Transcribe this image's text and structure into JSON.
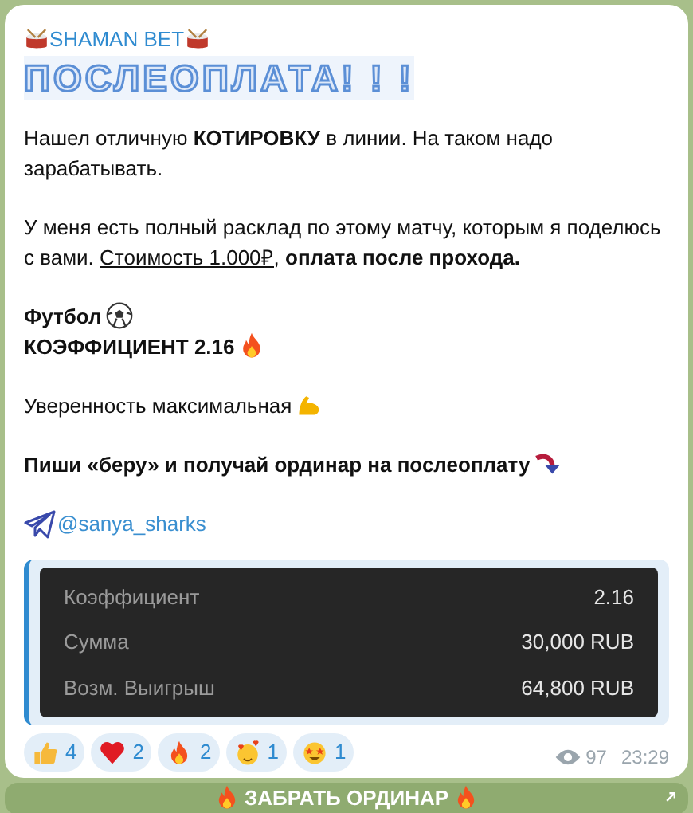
{
  "channel": {
    "name": "SHAMAN BET"
  },
  "headline": "ПОСЛЕОПЛАТА! ! !",
  "blocks": [
    {
      "kind": "para",
      "text": "Нашел отличную **КОТИРОВКУ** в линии. На таком надо зарабатывать."
    },
    {
      "kind": "para",
      "text": "У меня есть полный расклад по этому матчу, которым я поделюсь с вами.",
      "link": "Стоимость 1.000₽,",
      "tail": "**оплата после прохода.**"
    },
    {
      "kind": "lines",
      "lines": [
        {
          "text": "Футбол",
          "kind": "bold"
        },
        {
          "text": "КОЭФФИЦИЕНТ 2.16",
          "kind": "bold"
        }
      ]
    },
    {
      "kind": "lines",
      "lines": [
        {
          "text": "Уверенность максимальная",
          "kind": "plain"
        }
      ]
    },
    {
      "kind": "lines",
      "lines": [
        {
          "text": "Пиши «беру» и получай ординар на послеоплату",
          "kind": "bold"
        }
      ]
    },
    {
      "kind": "mention",
      "text": "@sanya_sharks"
    }
  ],
  "bet_table": {
    "rows": [
      {
        "label": "Коэффициент",
        "value": "2.16"
      },
      {
        "label": "Сумма",
        "value": "30,000 RUB"
      },
      {
        "label": "Возм. Выигрыш",
        "value": "64,800 RUB"
      }
    ]
  },
  "reactions": [
    {
      "count": "4"
    },
    {
      "count": "2"
    },
    {
      "count": "2"
    },
    {
      "count": "1"
    },
    {
      "count": "1"
    }
  ],
  "views": "97",
  "time": "23:29",
  "button": {
    "label": "ЗАБРАТЬ ОРДИНАР"
  }
}
